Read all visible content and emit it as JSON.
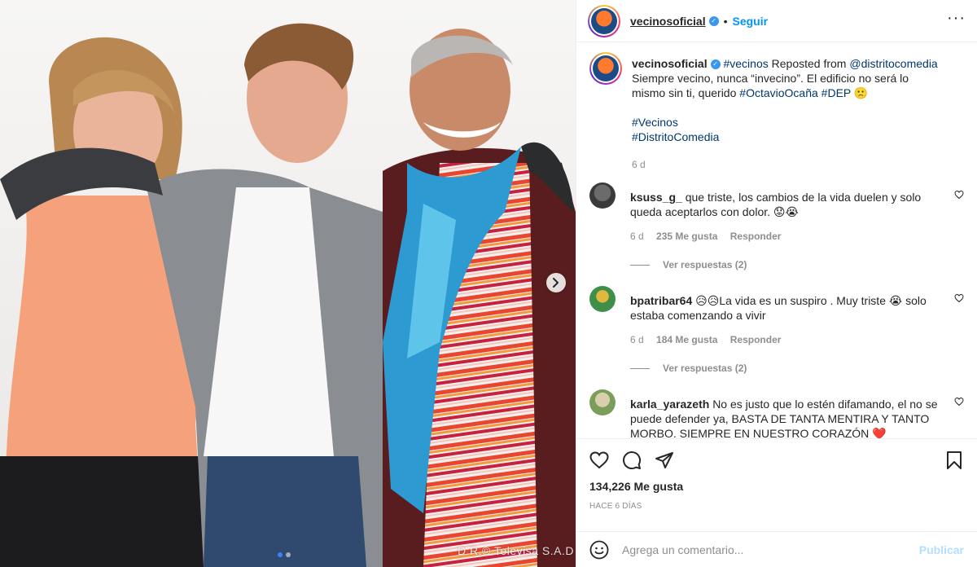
{
  "post": {
    "username": "vecinosoficial",
    "follow_label": "Seguir",
    "more_icon": "more-options-icon",
    "caption": {
      "hashtag_lead": "#vecinos",
      "reposted_from": "Reposted from",
      "reposted_user": "@distritocomedia",
      "body": "Siempre vecino, nunca “invecino”. El edificio no será lo mismo sin ti, querido",
      "tag_person": "#OctavioOcaña",
      "tag_dep": "#DEP",
      "tag_vecinos": "#Vecinos",
      "tag_distrito": "#DistritoComedia",
      "emoji": "🙁",
      "time": "6 d"
    },
    "watermark": "D.R.© Televisa S.A.D",
    "carousel": {
      "total": 2,
      "active": 0
    }
  },
  "comments": [
    {
      "username": "ksuss_g_",
      "text": "que triste, los cambios de la vida duelen y solo queda aceptarlos con dolor. 😟😭",
      "time": "6 d",
      "likes": "235 Me gusta",
      "reply": "Responder",
      "view_replies": "Ver respuestas (2)"
    },
    {
      "username": "bpatribar64",
      "text": "😥😥La vida es un suspiro . Muy triste 😭 solo estaba comenzando a vivir",
      "time": "6 d",
      "likes": "184 Me gusta",
      "reply": "Responder",
      "view_replies": "Ver respuestas (2)"
    },
    {
      "username": "karla_yarazeth",
      "text": "No es justo que lo estén difamando, el no se puede defender ya, BASTA DE TANTA MENTIRA Y TANTO MORBO. SIEMPRE EN NUESTRO CORAZÓN ❤️"
    }
  ],
  "actions": {
    "likes": "134,226 Me gusta",
    "ago": "HACE 6 DÍAS"
  },
  "composer": {
    "placeholder": "Agrega un comentario...",
    "publish": "Publicar"
  },
  "colors": {
    "accent": "#0095f6",
    "link": "#00376b",
    "muted": "#8e8e8e",
    "publish_disabled": "#b2dffc"
  }
}
